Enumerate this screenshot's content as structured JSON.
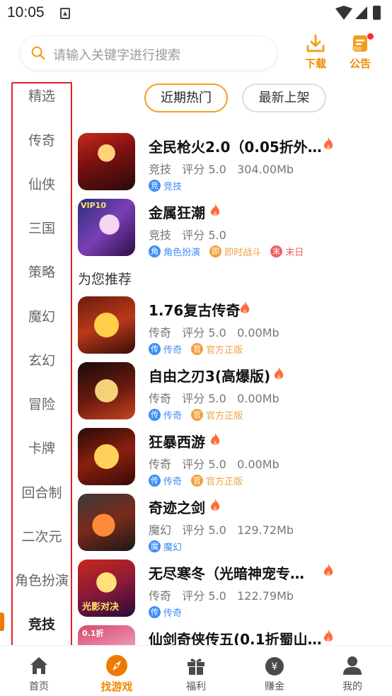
{
  "status_bar": {
    "time": "10:05"
  },
  "search": {
    "placeholder": "请输入关键字进行搜索"
  },
  "header_actions": {
    "download_label": "下载",
    "notice_label": "公告"
  },
  "sidebar": {
    "items": [
      {
        "label": "精选"
      },
      {
        "label": "传奇"
      },
      {
        "label": "仙侠"
      },
      {
        "label": "三国"
      },
      {
        "label": "策略"
      },
      {
        "label": "魔幻"
      },
      {
        "label": "玄幻"
      },
      {
        "label": "冒险"
      },
      {
        "label": "卡牌"
      },
      {
        "label": "回合制"
      },
      {
        "label": "二次元"
      },
      {
        "label": "角色扮演"
      },
      {
        "label": "竞技"
      }
    ],
    "active": "竞技"
  },
  "tabs": [
    {
      "label": "近期热门",
      "active": true
    },
    {
      "label": "最新上架",
      "active": false
    }
  ],
  "section_title": "为您推荐",
  "games": [
    {
      "title": "全民枪火2.0（0.05折外…",
      "category": "竞技",
      "rating": "评分 5.0",
      "size": "304.00Mb",
      "tags": [
        {
          "icon": "竞",
          "label": "竞技",
          "color": "#3d8df5"
        }
      ],
      "hot": true
    },
    {
      "title": "金属狂潮",
      "category": "竞技",
      "rating": "评分 5.0",
      "size": "",
      "tags": [
        {
          "icon": "角",
          "label": "角色扮演",
          "color": "#3d8df5"
        },
        {
          "icon": "即",
          "label": "即时战斗",
          "color": "#f0a040"
        },
        {
          "icon": "末",
          "label": "末日",
          "color": "#f06060"
        }
      ],
      "hot": true
    },
    {
      "title": "1.76复古传奇",
      "category": "传奇",
      "rating": "评分 5.0",
      "size": "0.00Mb",
      "tags": [
        {
          "icon": "传",
          "label": "传奇",
          "color": "#3d8df5"
        },
        {
          "icon": "官",
          "label": "官方正版",
          "color": "#f0a040"
        }
      ],
      "hot": true
    },
    {
      "title": "自由之刃3(高爆版)",
      "category": "传奇",
      "rating": "评分 5.0",
      "size": "0.00Mb",
      "tags": [
        {
          "icon": "传",
          "label": "传奇",
          "color": "#3d8df5"
        },
        {
          "icon": "官",
          "label": "官方正版",
          "color": "#f0a040"
        }
      ],
      "hot": true
    },
    {
      "title": "狂暴西游",
      "category": "传奇",
      "rating": "评分 5.0",
      "size": "0.00Mb",
      "tags": [
        {
          "icon": "传",
          "label": "传奇",
          "color": "#3d8df5"
        },
        {
          "icon": "官",
          "label": "官方正版",
          "color": "#f0a040"
        }
      ],
      "hot": true
    },
    {
      "title": "奇迹之剑",
      "category": "魔幻",
      "rating": "评分 5.0",
      "size": "129.72Mb",
      "tags": [
        {
          "icon": "魔",
          "label": "魔幻",
          "color": "#3d8df5"
        }
      ],
      "hot": true
    },
    {
      "title": "无尽寒冬（光暗神宠专…",
      "category": "传奇",
      "rating": "评分 5.0",
      "size": "122.79Mb",
      "tags": [
        {
          "icon": "传",
          "label": "传奇",
          "color": "#3d8df5"
        }
      ],
      "hot": true
    },
    {
      "title": "仙剑奇侠传五(0.1折蜀山…",
      "category": "",
      "rating": "",
      "size": "",
      "tags": [],
      "hot": true
    }
  ],
  "bottom_nav": [
    {
      "label": "首页",
      "icon": "home-icon"
    },
    {
      "label": "找游戏",
      "icon": "compass-icon"
    },
    {
      "label": "福利",
      "icon": "gift-icon"
    },
    {
      "label": "赚金",
      "icon": "money-bag-icon"
    },
    {
      "label": "我的",
      "icon": "user-icon"
    }
  ],
  "colors": {
    "accent": "#f08a00",
    "sidebar_border": "#e52222",
    "tag_blue": "#3d8df5",
    "tag_orange": "#f0a040",
    "tag_red": "#f06060"
  }
}
